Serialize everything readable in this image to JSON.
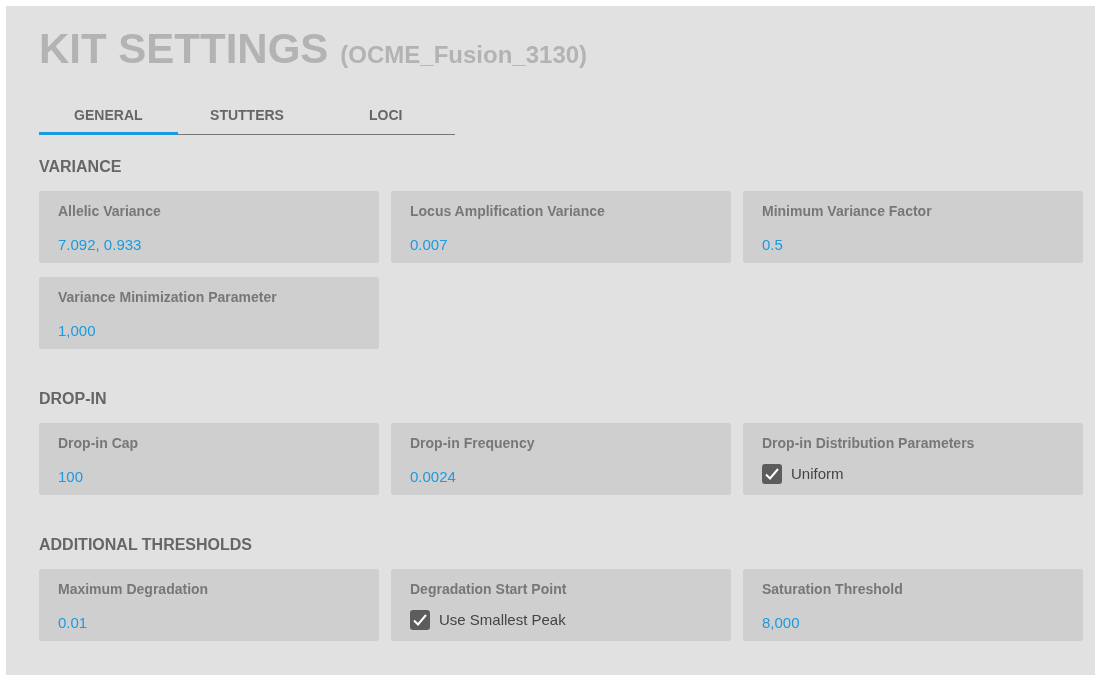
{
  "title": "KIT SETTINGS",
  "subtitle": "(OCME_Fusion_3130)",
  "tabs": [
    {
      "label": "GENERAL",
      "selected": true
    },
    {
      "label": "STUTTERS",
      "selected": false
    },
    {
      "label": "LOCI",
      "selected": false
    }
  ],
  "sections": [
    {
      "heading": "VARIANCE",
      "fields": [
        {
          "kind": "value",
          "label": "Allelic Variance",
          "value": "7.092, 0.933"
        },
        {
          "kind": "value",
          "label": "Locus Amplification Variance",
          "value": "0.007"
        },
        {
          "kind": "value",
          "label": "Minimum Variance Factor",
          "value": "0.5"
        },
        {
          "kind": "value",
          "label": "Variance Minimization Parameter",
          "value": "1,000"
        }
      ]
    },
    {
      "heading": "DROP-IN",
      "fields": [
        {
          "kind": "value",
          "label": "Drop-in Cap",
          "value": "100"
        },
        {
          "kind": "value",
          "label": "Drop-in Frequency",
          "value": "0.0024"
        },
        {
          "kind": "checkbox",
          "label": "Drop-in Distribution Parameters",
          "option": "Uniform",
          "checked": true
        }
      ]
    },
    {
      "heading": "ADDITIONAL THRESHOLDS",
      "fields": [
        {
          "kind": "value",
          "label": "Maximum Degradation",
          "value": "0.01"
        },
        {
          "kind": "checkbox",
          "label": "Degradation Start Point",
          "option": "Use Smallest Peak",
          "checked": true
        },
        {
          "kind": "value",
          "label": "Saturation Threshold",
          "value": "8,000"
        }
      ]
    }
  ]
}
